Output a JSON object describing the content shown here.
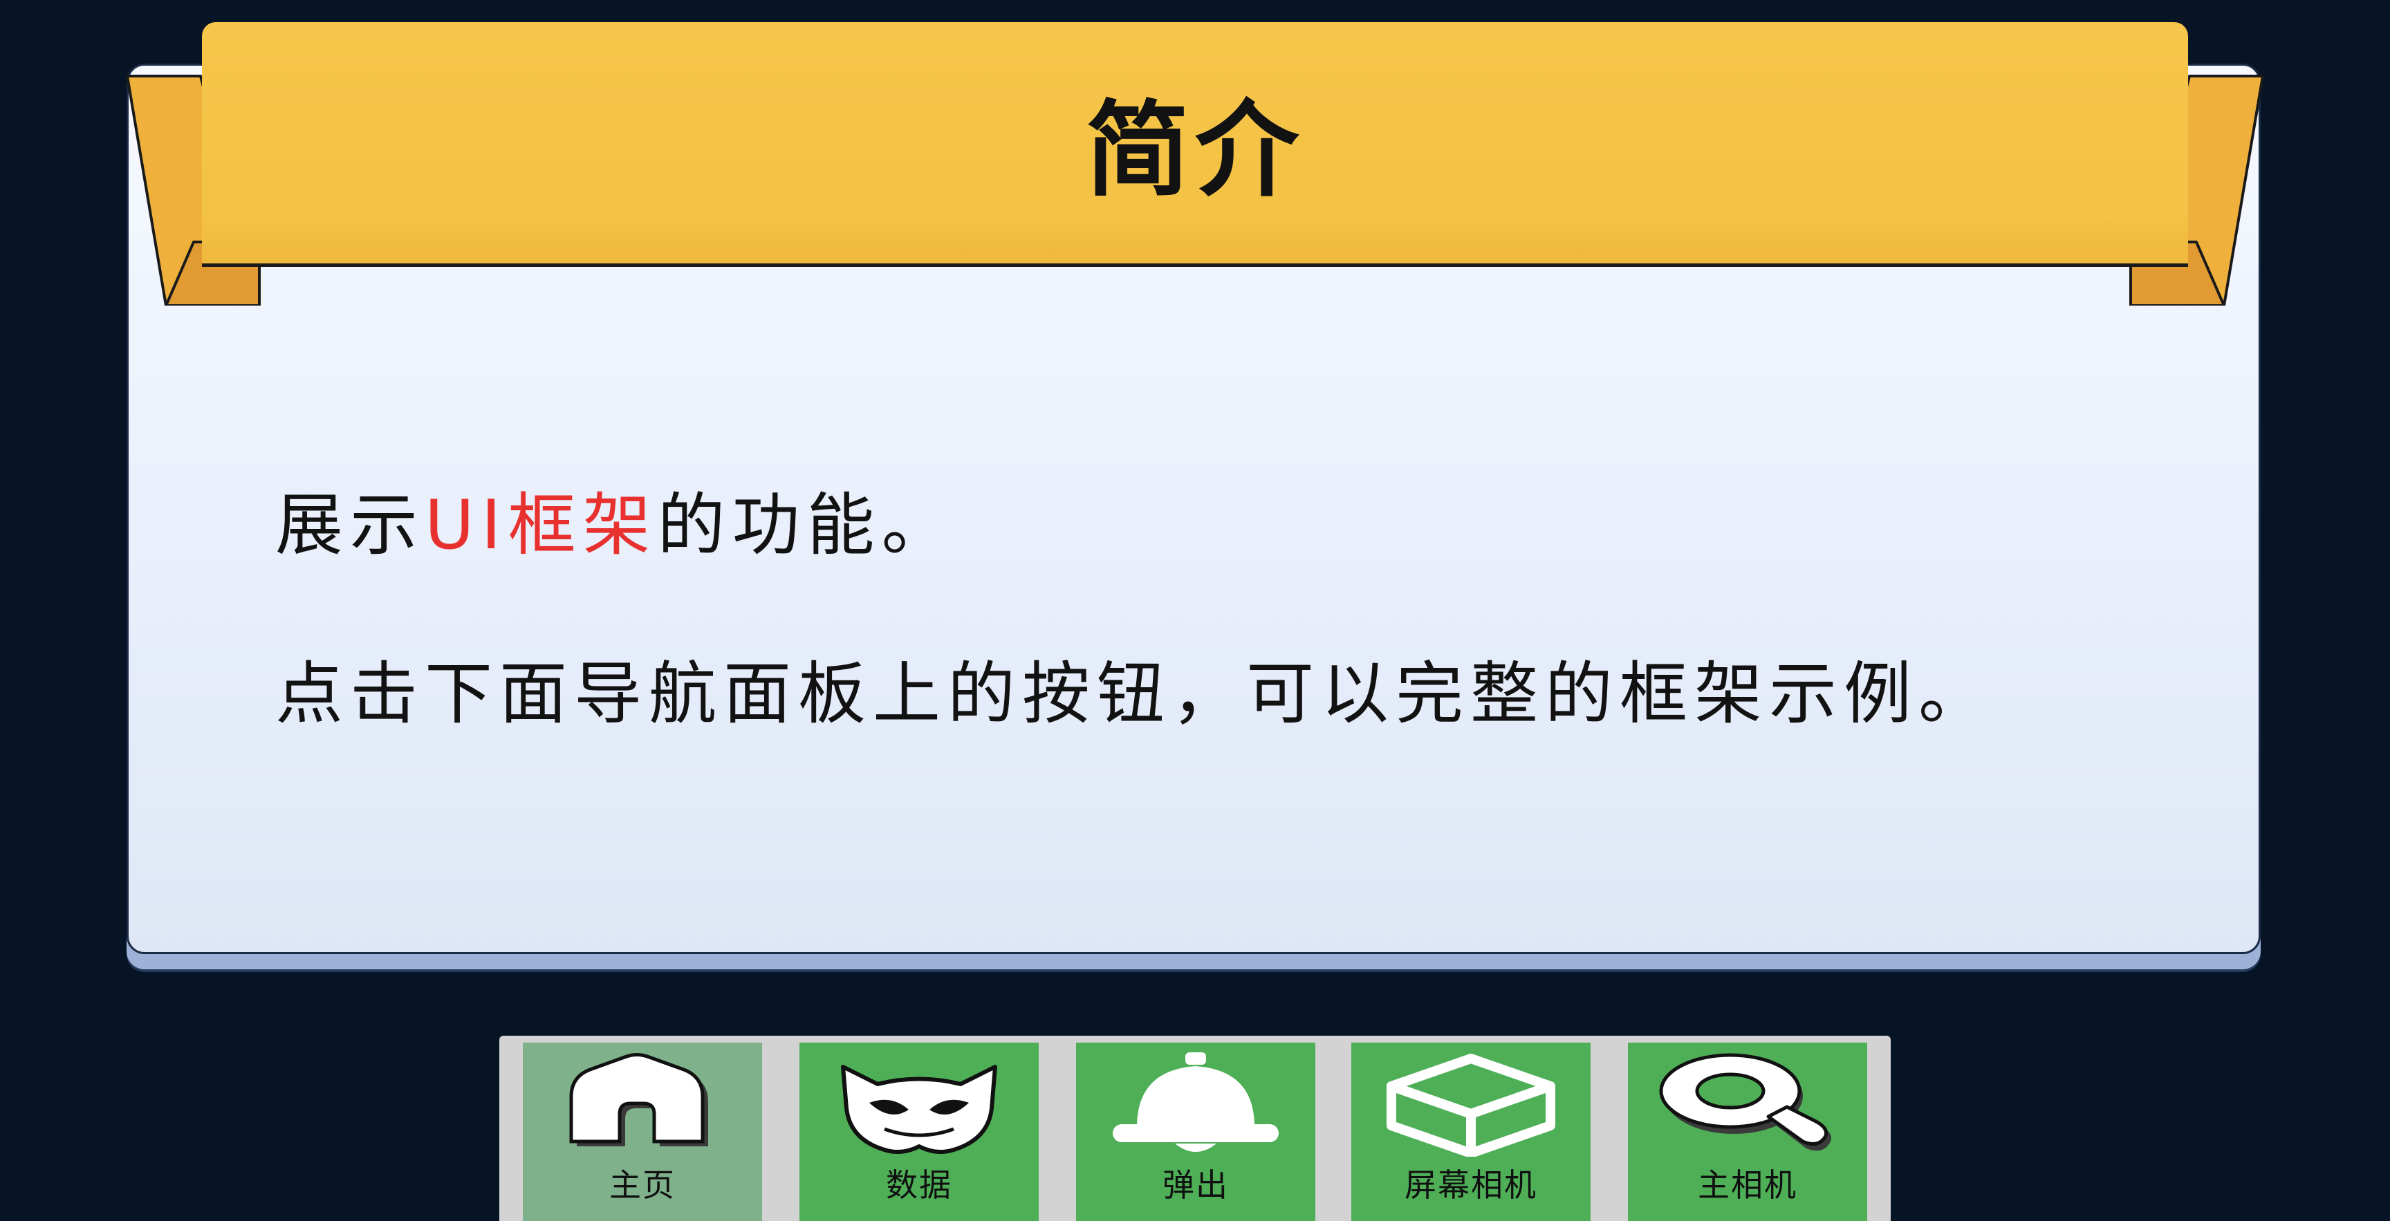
{
  "panel": {
    "title": "简介",
    "line1_prefix": "展示",
    "line1_highlight": "UI框架",
    "line1_suffix": "的功能。",
    "line2": "点击下面导航面板上的按钮，可以完整的框架示例。"
  },
  "nav": {
    "items": [
      {
        "label": "主页",
        "icon": "home-icon",
        "active": true
      },
      {
        "label": "数据",
        "icon": "cat-mask-icon",
        "active": false
      },
      {
        "label": "弹出",
        "icon": "bell-icon",
        "active": false
      },
      {
        "label": "屏幕相机",
        "icon": "box-icon",
        "active": false
      },
      {
        "label": "主相机",
        "icon": "magnifier-icon",
        "active": false
      }
    ]
  },
  "colors": {
    "background": "#061426",
    "ribbon": "#f4c244",
    "highlight": "#e8302e",
    "nav_button": "#4eaf57",
    "nav_button_active": "#7fb28a"
  }
}
